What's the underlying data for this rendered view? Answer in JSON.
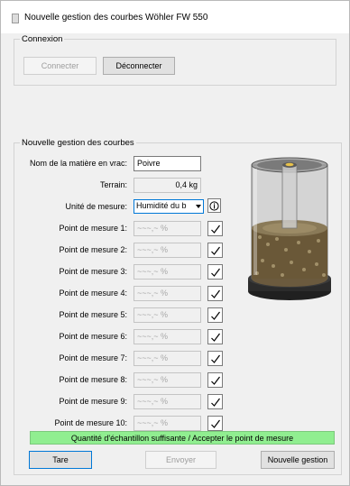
{
  "window": {
    "title": "Nouvelle gestion des courbes Wöhler FW 550"
  },
  "connection": {
    "legend": "Connexion",
    "connect_label": "Connecter",
    "disconnect_label": "Déconnecter"
  },
  "curves": {
    "legend": "Nouvelle gestion des courbes",
    "material_label": "Nom de la matière en vrac:",
    "material_value": "Poivre",
    "terrain_label": "Terrain:",
    "terrain_value": "0,4 kg",
    "unit_label": "Unité de mesure:",
    "unit_value": "Humidité du b",
    "measure_points": [
      {
        "label": "Point de mesure 1:",
        "value": "~~~,~ %"
      },
      {
        "label": "Point de mesure 2:",
        "value": "~~~,~ %"
      },
      {
        "label": "Point de mesure 3:",
        "value": "~~~,~ %"
      },
      {
        "label": "Point de mesure 4:",
        "value": "~~~,~ %"
      },
      {
        "label": "Point de mesure 5:",
        "value": "~~~,~ %"
      },
      {
        "label": "Point de mesure 6:",
        "value": "~~~,~ %"
      },
      {
        "label": "Point de mesure 7:",
        "value": "~~~,~ %"
      },
      {
        "label": "Point de mesure 8:",
        "value": "~~~,~ %"
      },
      {
        "label": "Point de mesure 9:",
        "value": "~~~,~ %"
      },
      {
        "label": "Point de mesure 10:",
        "value": "~~~,~ %"
      }
    ],
    "status_message": "Quantité d'échantillon suffisante / Accepter le point de mesure",
    "status_color": "#90ee90",
    "tare_label": "Tare",
    "send_label": "Envoyer",
    "new_label": "Nouvelle gestion"
  },
  "icons": {
    "info": "info-icon",
    "check": "checkmark-icon",
    "dropdown": "chevron-down-icon",
    "device": "sample-container-image"
  }
}
